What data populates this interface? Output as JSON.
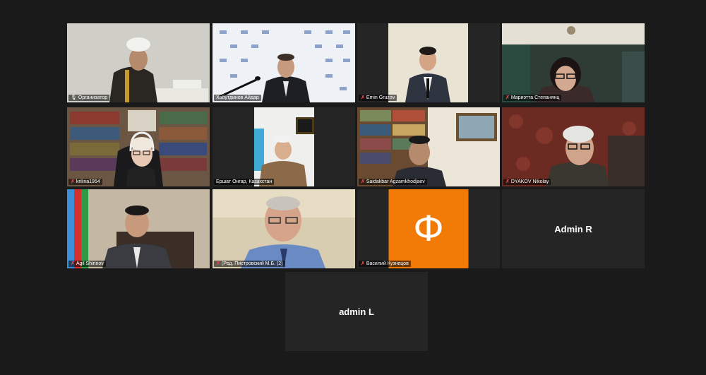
{
  "participants": [
    {
      "name": "Организатор",
      "status_icon": "mic-icon"
    },
    {
      "name": "Хабутдинов Айдар",
      "status_icon": "none"
    },
    {
      "name": "Emin Gruzov",
      "status_icon": "muted-mic-icon"
    },
    {
      "name": "Мариэтта Степанянц",
      "status_icon": "muted-mic-icon"
    },
    {
      "name": "krilina1954",
      "status_icon": "muted-mic-icon"
    },
    {
      "name": "Ершат Онгар, Казахстан",
      "status_icon": "none"
    },
    {
      "name": "Saidakbar Agzamkhodjaev",
      "status_icon": "muted-mic-icon"
    },
    {
      "name": "DYAKOV Nikolay",
      "status_icon": "muted-mic-icon"
    },
    {
      "name": "Agil Shirinov",
      "status_icon": "muted-mic-icon"
    },
    {
      "name": "(Ред. Пистровский М.Б. (2)",
      "status_icon": "muted-mic-icon"
    },
    {
      "name": "Василий Кузнецов",
      "status_icon": "muted-mic-icon",
      "avatar_letter": "Ф",
      "avatar_color": "#f27b07"
    },
    {
      "name": "Admin R",
      "status_icon": "none"
    },
    {
      "name": "admin L",
      "status_icon": "none"
    }
  ],
  "colors": {
    "background": "#1a1a1a",
    "tile": "#252525",
    "active_speaker": "#c8d94a",
    "muted": "#e5484d"
  }
}
